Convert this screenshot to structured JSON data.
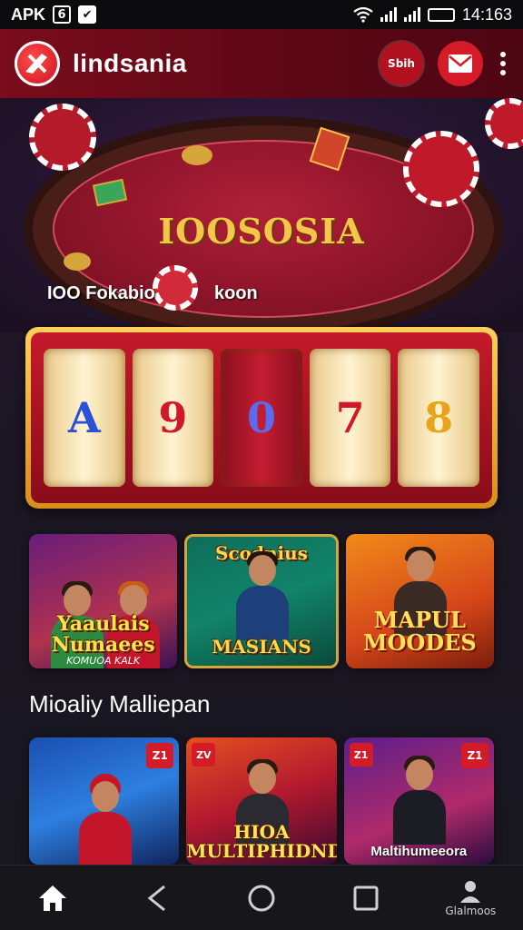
{
  "status_bar": {
    "carrier": "APK",
    "icon_a": "6",
    "icon_b": "✔",
    "time": "14:163"
  },
  "app_bar": {
    "title": "lindsania",
    "pill_label": "Sbih",
    "icons": [
      "logo-icon",
      "mail-icon",
      "more-vert-icon"
    ]
  },
  "hero": {
    "table_title": "IOOSOSIA",
    "caption_left": "IOO Fokabio",
    "caption_right": "koon"
  },
  "slot": {
    "reels": [
      "A",
      "9",
      "0",
      "7",
      "8"
    ]
  },
  "games_row1": [
    {
      "title": "Yaaulais Numaees",
      "subtitle": "KOMUOA KALK"
    },
    {
      "title_top": "Scodnius",
      "title_bottom": "MASIANS"
    },
    {
      "title": "MAPUL MOODES"
    }
  ],
  "section": {
    "title": "Mioaliy Malliepan"
  },
  "games_row2": [
    {
      "badge": "Z1"
    },
    {
      "badge": "ZV",
      "title": "HIOA MULTIPHIDNDS"
    },
    {
      "badge_left": "Z1",
      "badge": "Z1",
      "label": "Maltihumeeora"
    }
  ],
  "bottom_nav": {
    "items": [
      "home-icon",
      "back-icon",
      "circle-home-icon",
      "recents-icon",
      "profile-icon"
    ],
    "profile_label": "Glalmoos"
  },
  "colors": {
    "app_bar": "#7a0c1c",
    "accent_red": "#d41c28",
    "gold": "#f3c64a",
    "background": "#17161e"
  }
}
